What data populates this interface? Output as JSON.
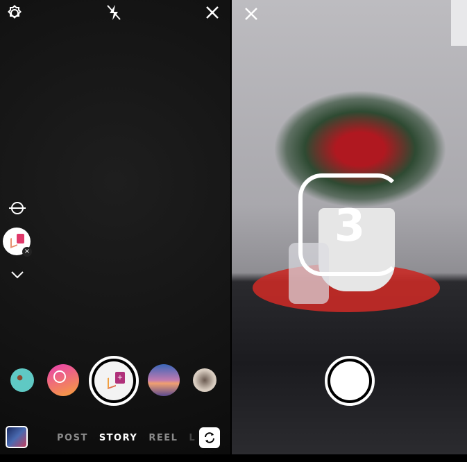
{
  "left": {
    "top_bar": {
      "settings_icon": "gear-icon",
      "flash_icon": "flash-off-icon",
      "close_icon": "close-icon"
    },
    "side_tools": {
      "level_icon": "level-icon",
      "effect_icon": "layout-effect-icon",
      "remove_icon": "close-icon",
      "more_icon": "chevron-down-icon"
    },
    "effects_carousel": [
      {
        "name": "effect-cookies",
        "color": "#5fc9c4"
      },
      {
        "name": "effect-smiley",
        "color": "#f26b8a"
      },
      {
        "name": "effect-selected-layout",
        "color": "#ffffff"
      },
      {
        "name": "effect-sunset",
        "color": "#5a6fb0"
      },
      {
        "name": "effect-brushes",
        "color": "#d8ccc0"
      }
    ],
    "modes": [
      "POST",
      "STORY",
      "REEL",
      "L"
    ],
    "active_mode": "STORY",
    "gallery_icon": "gallery-thumbnail",
    "flip_camera_icon": "flip-camera-icon"
  },
  "right": {
    "close_icon": "close-icon",
    "countdown": "3",
    "shutter_icon": "shutter-button"
  }
}
